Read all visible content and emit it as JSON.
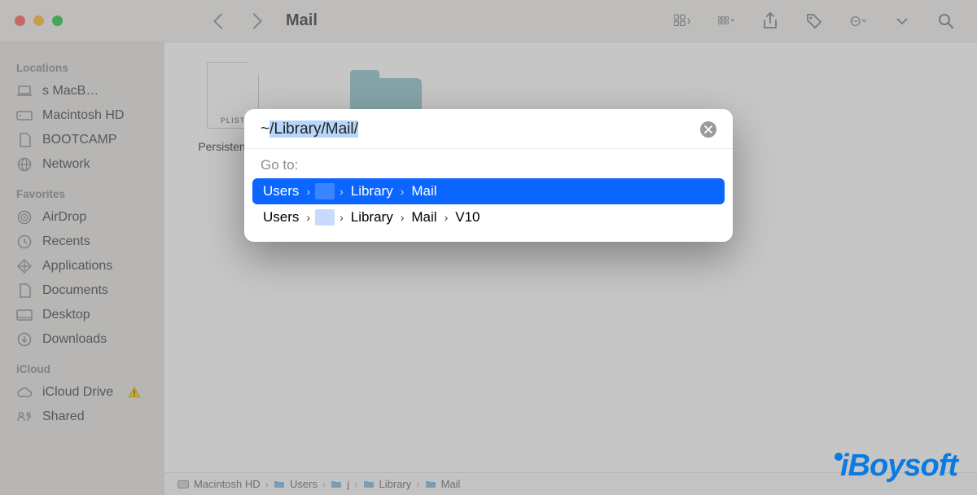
{
  "window_title": "Mail",
  "sidebar": {
    "sections": [
      {
        "header": "Locations",
        "items": [
          {
            "label": "s MacB…",
            "icon": "laptop"
          },
          {
            "label": "Macintosh HD",
            "icon": "hdd"
          },
          {
            "label": "BOOTCAMP",
            "icon": "doc"
          },
          {
            "label": "Network",
            "icon": "globe"
          }
        ]
      },
      {
        "header": "Favorites",
        "items": [
          {
            "label": "AirDrop",
            "icon": "airdrop"
          },
          {
            "label": "Recents",
            "icon": "clock"
          },
          {
            "label": "Applications",
            "icon": "apps"
          },
          {
            "label": "Documents",
            "icon": "doc"
          },
          {
            "label": "Desktop",
            "icon": "desktop"
          },
          {
            "label": "Downloads",
            "icon": "download"
          }
        ]
      },
      {
        "header": "iCloud",
        "items": [
          {
            "label": "iCloud Drive",
            "icon": "cloud",
            "warning": true
          },
          {
            "label": "Shared",
            "icon": "shared"
          }
        ]
      }
    ]
  },
  "files": [
    {
      "name": "Persistenc…ist",
      "type": "plist",
      "badge": "PLIST"
    },
    {
      "name": "",
      "type": "folder"
    }
  ],
  "pathbar": [
    "Macintosh HD",
    "Users",
    "j",
    "Library",
    "Mail"
  ],
  "dialog": {
    "input_value": "~/Library/Mail/",
    "goto_label": "Go to:",
    "suggestions": [
      {
        "parts": [
          "Users",
          "",
          "Library",
          "Mail"
        ],
        "selected": true
      },
      {
        "parts": [
          "Users",
          "",
          "Library",
          "Mail",
          "V10"
        ],
        "selected": false
      }
    ]
  },
  "watermark": "iBoysoft"
}
